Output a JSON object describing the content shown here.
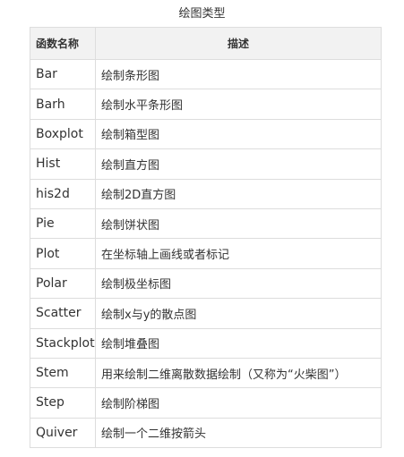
{
  "caption": "绘图类型",
  "table": {
    "headers": {
      "name": "函数名称",
      "description": "描述"
    },
    "rows": [
      {
        "name": "Bar",
        "description": "绘制条形图"
      },
      {
        "name": "Barh",
        "description": "绘制水平条形图"
      },
      {
        "name": "Boxplot",
        "description": "绘制箱型图"
      },
      {
        "name": "Hist",
        "description": "绘制直方图"
      },
      {
        "name": "his2d",
        "description": "绘制2D直方图"
      },
      {
        "name": "Pie",
        "description": "绘制饼状图"
      },
      {
        "name": "Plot",
        "description": "在坐标轴上画线或者标记"
      },
      {
        "name": "Polar",
        "description": "绘制极坐标图"
      },
      {
        "name": "Scatter",
        "description": "绘制x与y的散点图"
      },
      {
        "name": "Stackplot",
        "description": "绘制堆叠图"
      },
      {
        "name": "Stem",
        "description": "用来绘制二维离散数据绘制（又称为“火柴图”）"
      },
      {
        "name": "Step",
        "description": "绘制阶梯图"
      },
      {
        "name": "Quiver",
        "description": "绘制一个二维按箭头"
      }
    ]
  }
}
